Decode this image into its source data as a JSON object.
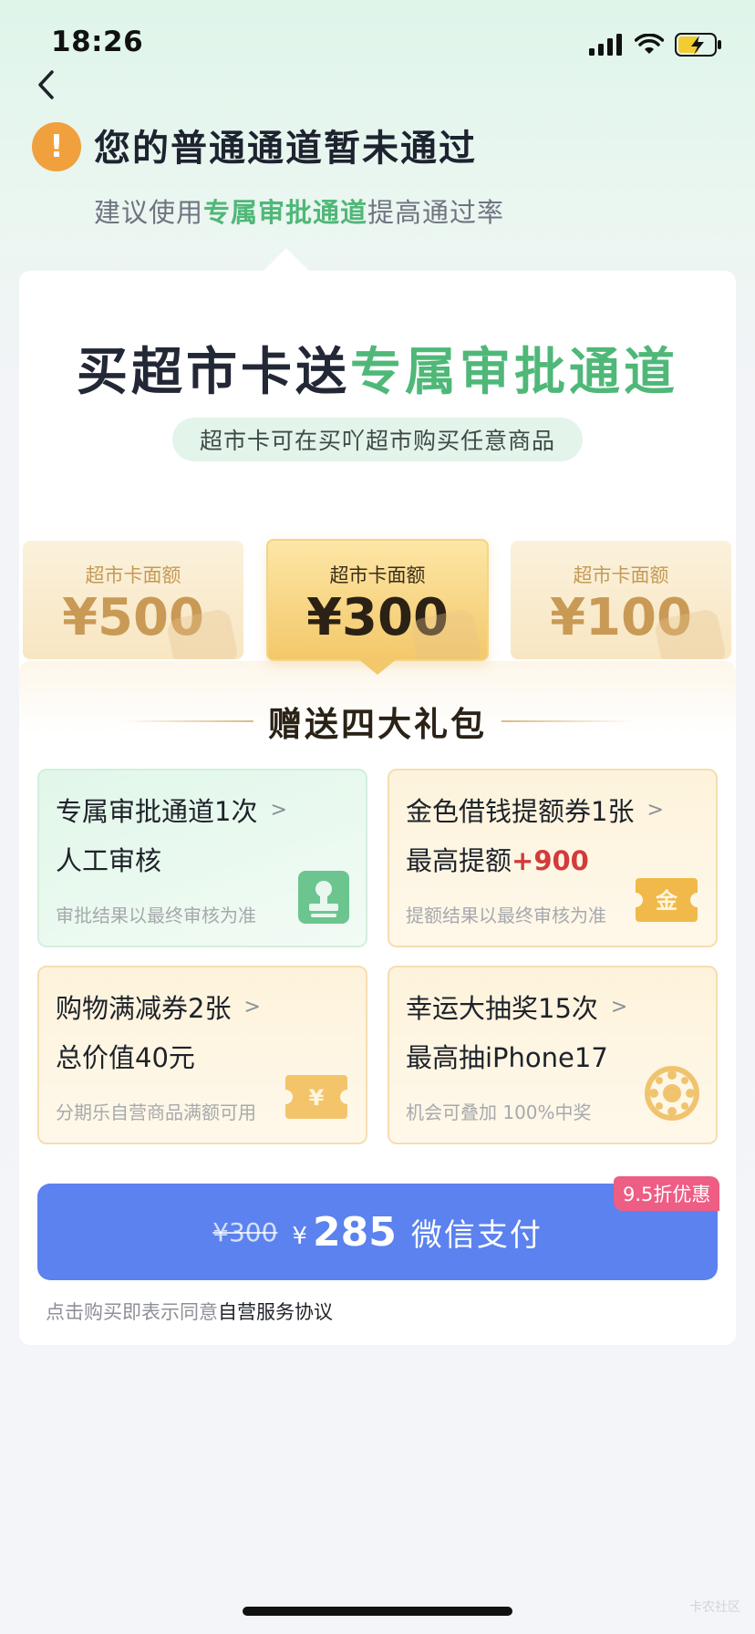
{
  "status": {
    "time": "18:26"
  },
  "header": {
    "title": "您的普通通道暂未通过",
    "subtitle_prefix": "建议使用",
    "subtitle_highlight": "专属审批通道",
    "subtitle_suffix": "提高通过率"
  },
  "promo": {
    "title_main": "买超市卡送",
    "title_green": "专属审批通道",
    "pill": "超市卡可在买吖超市购买任意商品"
  },
  "amounts": [
    {
      "label": "超市卡面额",
      "value": "¥500",
      "selected": false
    },
    {
      "label": "超市卡面额",
      "value": "¥300",
      "selected": true
    },
    {
      "label": "超市卡面额",
      "value": "¥100",
      "selected": false
    }
  ],
  "gifts": {
    "heading": "赠送四大礼包",
    "items": [
      {
        "title": "专属审批通道1次",
        "line2": "人工审核",
        "line2_highlight": "",
        "foot": "审批结果以最终审核为准",
        "icon": "approval-stamp-icon"
      },
      {
        "title": "金色借钱提额券1张",
        "line2": "最高提额",
        "line2_highlight": "+900",
        "foot": "提额结果以最终审核为准",
        "icon": "gold-ticket-icon",
        "icon_text": "金"
      },
      {
        "title": "购物满减券2张",
        "line2": "总价值40元",
        "line2_highlight": "",
        "foot": "分期乐自营商品满额可用",
        "icon": "yen-ticket-icon",
        "icon_text": "¥"
      },
      {
        "title": "幸运大抽奖15次",
        "line2": "最高抽iPhone17",
        "line2_highlight": "",
        "foot": "机会可叠加 100%中奖",
        "icon": "lottery-wheel-icon"
      }
    ]
  },
  "payment": {
    "badge": "9.5折优惠",
    "old_price": "¥300",
    "currency": "¥",
    "price": "285",
    "label": "微信支付"
  },
  "agreement": {
    "prefix": "点击购买即表示同意",
    "link": "自营服务协议"
  },
  "watermark": "卡农社区",
  "colors": {
    "accent_green": "#4fb878",
    "pay_blue": "#5b82ee",
    "badge_pink": "#ee5d83",
    "warn_orange": "#f0a03c"
  }
}
